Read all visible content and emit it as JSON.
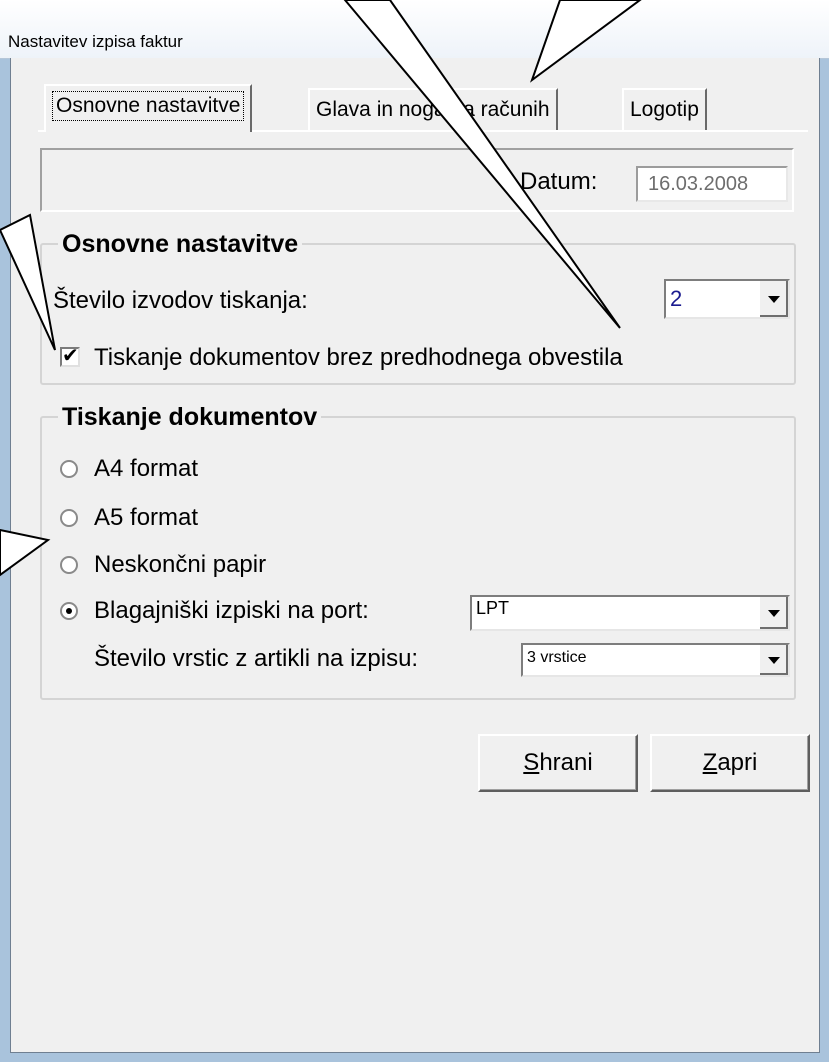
{
  "window": {
    "title": "Nastavitev izpisa faktur"
  },
  "tabs": [
    {
      "label": "Osnovne nastavitve",
      "active": true
    },
    {
      "label": "Glava in noga na računih",
      "active": false
    },
    {
      "label": "Logotip",
      "active": false
    }
  ],
  "datum": {
    "label": "Datum:",
    "value": "16.03.2008"
  },
  "basic": {
    "title": "Osnovne nastavitve",
    "copies_label": "Število izvodov tiskanja:",
    "copies_value": "2",
    "no_prompt_label": "Tiskanje dokumentov brez predhodnega obvestila",
    "no_prompt_checked": true
  },
  "printing": {
    "title": "Tiskanje dokumentov",
    "options": [
      {
        "label": "A4 format",
        "selected": false
      },
      {
        "label": "A5 format",
        "selected": false
      },
      {
        "label": "Neskončni papir",
        "selected": false
      },
      {
        "label": "Blagajniški izpiski na port:",
        "selected": true
      }
    ],
    "port_value": "LPT",
    "rows_label": "Število vrstic z artikli na izpisu:",
    "rows_value": "3 vrstice"
  },
  "buttons": {
    "save_mnemonic": "S",
    "save_rest": "hrani",
    "close_mnemonic": "Z",
    "close_rest": "apri"
  },
  "colors": {
    "window_frame": "#a9c3dc",
    "dialog_bg": "#f0f0f0",
    "disabled_text": "#6d6d6d",
    "value_text": "#1b1b8f"
  }
}
